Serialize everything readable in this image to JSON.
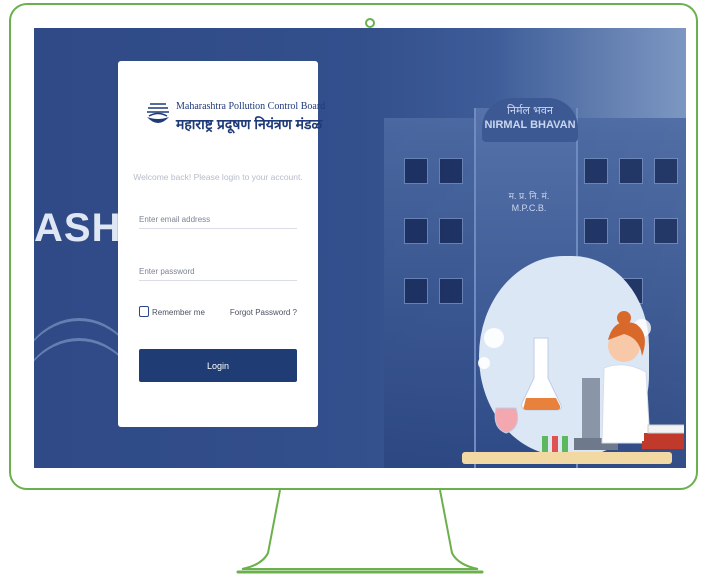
{
  "logo": {
    "english": "Maharashtra Pollution Control Board",
    "marathi": "महाराष्ट्र प्रदूषण नियंत्रण मंडळ"
  },
  "login": {
    "welcome": "Welcome back! Please login to your account.",
    "email_placeholder": "Enter email address",
    "password_placeholder": "Enter password",
    "remember_label": "Remember me",
    "forgot_label": "Forgot Password ?",
    "button_label": "Login"
  },
  "background": {
    "sign_marathi": "निर्मल भवन",
    "sign_english": "NIRMAL BHAVAN",
    "sign_short_marathi": "म. प्र. नि. मं.",
    "sign_short_english": "M.P.C.B.",
    "wall_letters": "ASH"
  },
  "colors": {
    "frame": "#6ab04c",
    "primary": "#1f3c75",
    "background": "#2f4a86"
  }
}
